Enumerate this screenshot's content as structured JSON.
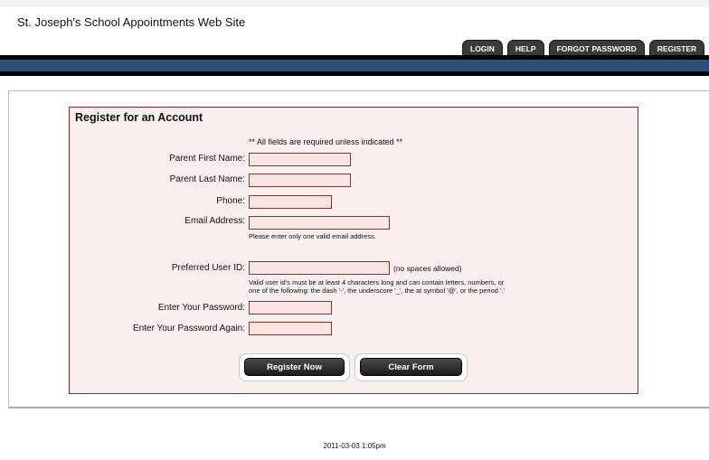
{
  "site": {
    "title": "St. Joseph's School Appointments Web Site"
  },
  "nav": {
    "tabs": [
      "LOGIN",
      "HELP",
      "FORGOT PASSWORD",
      "REGISTER"
    ]
  },
  "form": {
    "heading": "Register for an Account",
    "required_note": "** All fields are required unless indicated **",
    "fields": {
      "first_name": {
        "label": "Parent First Name:",
        "value": ""
      },
      "last_name": {
        "label": "Parent Last Name:",
        "value": ""
      },
      "phone": {
        "label": "Phone:",
        "value": ""
      },
      "email": {
        "label": "Email Address:",
        "value": "",
        "hint": "Please enter only one valid email address."
      },
      "user_id": {
        "label": "Preferred User ID:",
        "value": "",
        "note": "(no spaces allowed)",
        "hint_line1": "Valid user id's must be at least 4 characters long and can contain letters, numbers, or",
        "hint_line2": "one of the following: the dash '-', the underscore '_', the at symbol '@', or the period '.'"
      },
      "password": {
        "label": "Enter Your Password:",
        "value": ""
      },
      "password_again": {
        "label": "Enter Your Password Again:",
        "value": ""
      }
    },
    "buttons": {
      "register": "Register Now",
      "clear": "Clear Form"
    }
  },
  "footer": {
    "timestamp": "2011-03-03 1:05pm"
  },
  "colors": {
    "nav_band": "#2d4f78",
    "panel_border": "#8b2a2a",
    "panel_bg": "#f8eeee",
    "input_bg": "#fbe4e4"
  }
}
